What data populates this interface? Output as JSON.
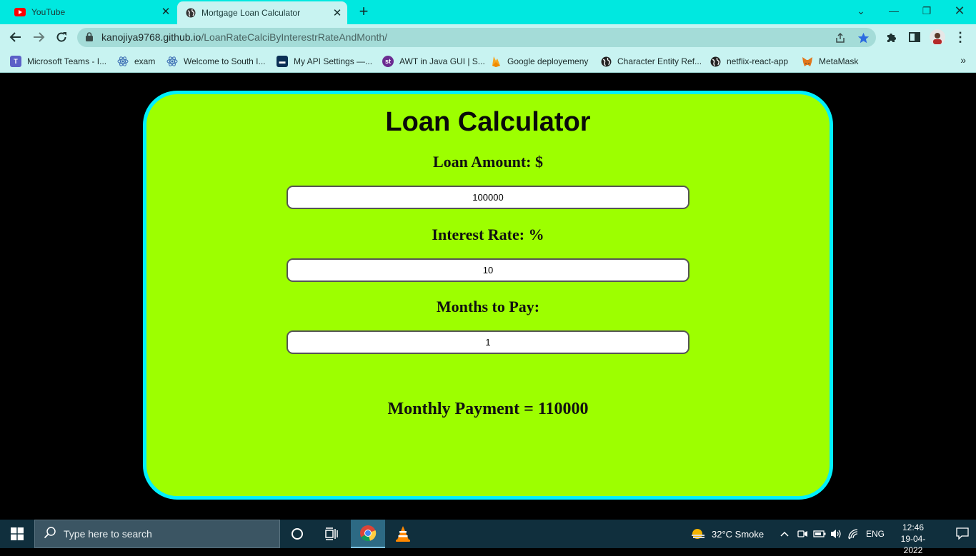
{
  "browser": {
    "tabs": [
      {
        "label": "YouTube",
        "icon": "youtube-icon",
        "active": false
      },
      {
        "label": "Mortgage Loan Calculator",
        "icon": "globe-icon",
        "active": true
      }
    ],
    "url_host": "kanojiya9768.github.io",
    "url_path": "/LoanRateCalciByInterestrRateAndMonth/",
    "bookmarks": [
      {
        "label": "Microsoft Teams - I...",
        "icon": "teams-icon",
        "color": "#5b5fc7"
      },
      {
        "label": "exam",
        "icon": "react-icon",
        "color": "#3b6db3"
      },
      {
        "label": "Welcome to South I...",
        "icon": "react-icon",
        "color": "#3b6db3"
      },
      {
        "label": "My API Settings —...",
        "icon": "api-icon",
        "color": "#0a2f55"
      },
      {
        "label": "AWT in Java GUI | S...",
        "icon": "st-icon",
        "color": "#6b2c91"
      },
      {
        "label": "Google deployemeny",
        "icon": "firebase-icon",
        "color": "#f5a623"
      },
      {
        "label": "Character Entity Ref...",
        "icon": "globe-icon",
        "color": "#222"
      },
      {
        "label": "netflix-react-app",
        "icon": "globe-icon",
        "color": "#222"
      },
      {
        "label": "MetaMask",
        "icon": "metamask-icon",
        "color": "#e2761b"
      }
    ],
    "more_bookmarks": "»"
  },
  "calculator": {
    "title": "Loan Calculator",
    "loan_amount_label": "Loan Amount: $",
    "loan_amount_value": "100000",
    "interest_rate_label": "Interest Rate: %",
    "interest_rate_value": "10",
    "months_label": "Months to Pay:",
    "months_value": "1",
    "result_text": "Monthly Payment = 110000"
  },
  "taskbar": {
    "search_placeholder": "Type here to search",
    "weather": "32°C  Smoke",
    "language": "ENG",
    "time": "12:46",
    "date": "19-04-2022"
  },
  "colors": {
    "tab_bar": "#00e8e0",
    "card_bg": "#9dff00",
    "card_border": "#00f0ff"
  }
}
